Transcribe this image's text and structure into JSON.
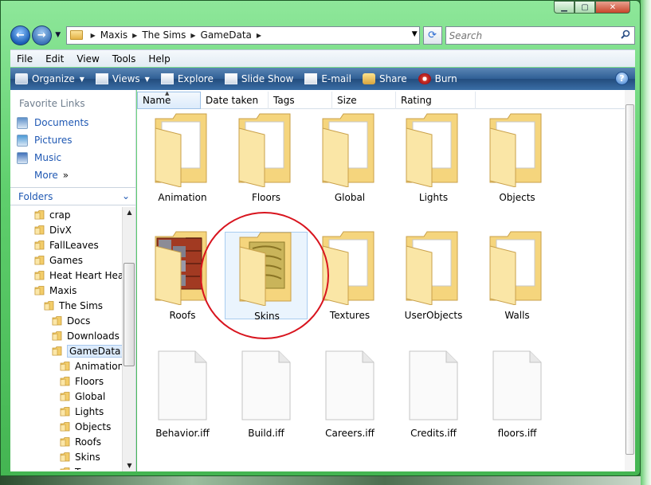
{
  "address": {
    "crumbs": [
      "Maxis",
      "The Sims",
      "GameData"
    ]
  },
  "search": {
    "placeholder": "Search"
  },
  "menu": [
    "File",
    "Edit",
    "View",
    "Tools",
    "Help"
  ],
  "commands": [
    {
      "label": "Organize",
      "icon": "organize-icon",
      "dropdown": true
    },
    {
      "label": "Views",
      "icon": "views-icon",
      "dropdown": true
    },
    {
      "label": "Explore",
      "icon": "explore-icon",
      "dropdown": false
    },
    {
      "label": "Slide Show",
      "icon": "slideshow-icon",
      "dropdown": false
    },
    {
      "label": "E-mail",
      "icon": "email-icon",
      "dropdown": false
    },
    {
      "label": "Share",
      "icon": "share-icon",
      "dropdown": false
    },
    {
      "label": "Burn",
      "icon": "burn-icon",
      "dropdown": false
    }
  ],
  "favorites": {
    "header": "Favorite Links",
    "links": [
      {
        "label": "Documents",
        "icon": "documents-icon"
      },
      {
        "label": "Pictures",
        "icon": "pictures-icon"
      },
      {
        "label": "Music",
        "icon": "music-icon"
      }
    ],
    "more": "More"
  },
  "folders": {
    "header": "Folders",
    "tree": [
      {
        "label": "crap",
        "indent": 0
      },
      {
        "label": "DivX",
        "indent": 0
      },
      {
        "label": "FallLeaves",
        "indent": 0
      },
      {
        "label": "Games",
        "indent": 0
      },
      {
        "label": "Heat Heart Heav",
        "indent": 0
      },
      {
        "label": "Maxis",
        "indent": 0
      },
      {
        "label": "The Sims",
        "indent": 1
      },
      {
        "label": "Docs",
        "indent": 2
      },
      {
        "label": "Downloads",
        "indent": 2
      },
      {
        "label": "GameData",
        "indent": 2,
        "selected": true
      },
      {
        "label": "Animation",
        "indent": 3
      },
      {
        "label": "Floors",
        "indent": 3
      },
      {
        "label": "Global",
        "indent": 3
      },
      {
        "label": "Lights",
        "indent": 3
      },
      {
        "label": "Objects",
        "indent": 3
      },
      {
        "label": "Roofs",
        "indent": 3
      },
      {
        "label": "Skins",
        "indent": 3
      },
      {
        "label": "Tex",
        "indent": 3
      }
    ]
  },
  "columns": [
    "Name",
    "Date taken",
    "Tags",
    "Size",
    "Rating"
  ],
  "items": [
    {
      "name": "Animation",
      "kind": "folder"
    },
    {
      "name": "Floors",
      "kind": "folder"
    },
    {
      "name": "Global",
      "kind": "folder"
    },
    {
      "name": "Lights",
      "kind": "folder"
    },
    {
      "name": "Objects",
      "kind": "folder"
    },
    {
      "name": "Roofs",
      "kind": "folder-roofs"
    },
    {
      "name": "Skins",
      "kind": "folder-skins",
      "selected": true
    },
    {
      "name": "Textures",
      "kind": "folder"
    },
    {
      "name": "UserObjects",
      "kind": "folder"
    },
    {
      "name": "Walls",
      "kind": "folder"
    },
    {
      "name": "Behavior.iff",
      "kind": "file"
    },
    {
      "name": "Build.iff",
      "kind": "file"
    },
    {
      "name": "Careers.iff",
      "kind": "file"
    },
    {
      "name": "Credits.iff",
      "kind": "file"
    },
    {
      "name": "floors.iff",
      "kind": "file"
    }
  ],
  "colors": {
    "link": "#1f58b3",
    "annotation_circle": "#d8141e",
    "frame_green": "#5fcf6d"
  }
}
